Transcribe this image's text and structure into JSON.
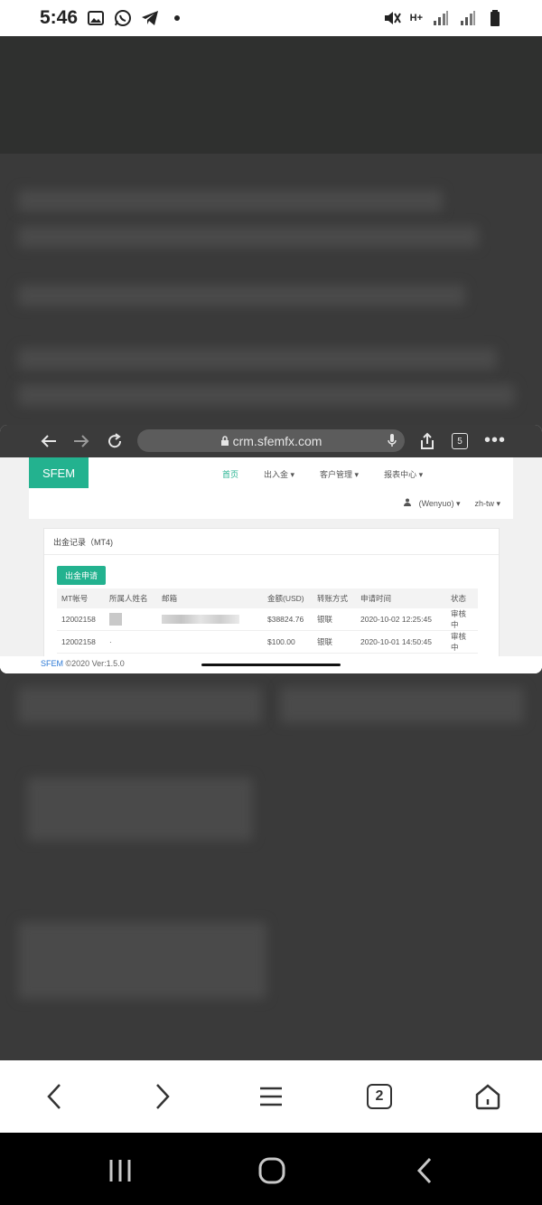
{
  "status_bar": {
    "time": "5:46",
    "network": "H+"
  },
  "browser_toolbar": {
    "url": "crm.sfemfx.com",
    "tab_count": "5",
    "more": "•••"
  },
  "site": {
    "logo": "SFEM",
    "menu": [
      {
        "label": "首页",
        "active": true
      },
      {
        "label": "出入金 ▾",
        "active": false
      },
      {
        "label": "客户管理 ▾",
        "active": false
      },
      {
        "label": "报表中心 ▾",
        "active": false
      }
    ],
    "user": "(Wenyuo) ▾",
    "lang": "zh-tw ▾"
  },
  "panel": {
    "title": "出金记录（MT4)",
    "apply_button": "出金申请",
    "columns": [
      "MT帐号",
      "所属人姓名",
      "邮箱",
      "金额(USD)",
      "转账方式",
      "申请时间",
      "状态"
    ],
    "rows": [
      {
        "account": "12002158",
        "amount": "$38824.76",
        "method": "银联",
        "time": "2020-10-02 12:25:45",
        "status": "审核中"
      },
      {
        "account": "12002158",
        "amount": "$100.00",
        "method": "银联",
        "time": "2020-10-01 14:50:45",
        "status": "审核中"
      }
    ]
  },
  "footer": {
    "brand": "SFEM",
    "text": " ©2020 Ver:1.5.0"
  },
  "bottom_bar": {
    "tab_count": "2"
  }
}
